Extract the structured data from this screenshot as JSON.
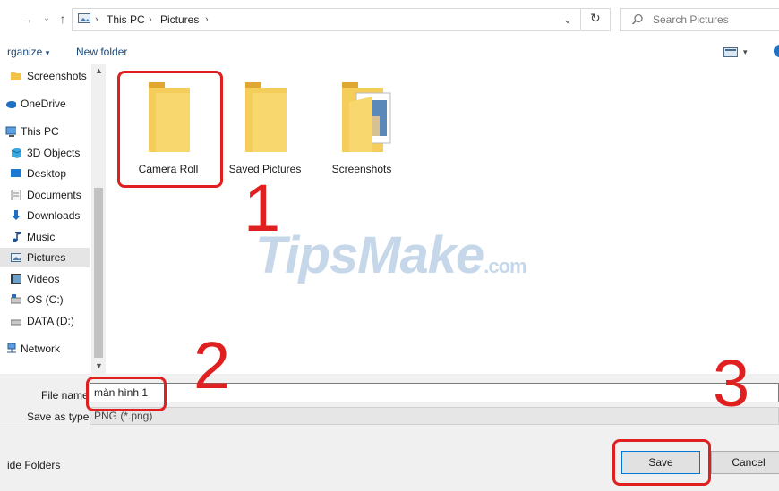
{
  "address_bar": {
    "breadcrumbs": [
      "This PC",
      "Pictures"
    ],
    "search_placeholder": "Search Pictures"
  },
  "command_bar": {
    "organize_label": "rganize",
    "new_folder_label": "New folder"
  },
  "nav_pane": {
    "items": [
      {
        "label": "Screenshots",
        "icon": "folder-icon",
        "selected": false
      },
      {
        "label": "OneDrive",
        "icon": "cloud-icon",
        "selected": false
      },
      {
        "label": "This PC",
        "icon": "computer-icon",
        "selected": false
      },
      {
        "label": "3D Objects",
        "icon": "cube-icon",
        "selected": false
      },
      {
        "label": "Desktop",
        "icon": "desktop-icon",
        "selected": false
      },
      {
        "label": "Documents",
        "icon": "document-icon",
        "selected": false
      },
      {
        "label": "Downloads",
        "icon": "download-icon",
        "selected": false
      },
      {
        "label": "Music",
        "icon": "music-icon",
        "selected": false
      },
      {
        "label": "Pictures",
        "icon": "pictures-icon",
        "selected": true
      },
      {
        "label": "Videos",
        "icon": "video-icon",
        "selected": false
      },
      {
        "label": "OS (C:)",
        "icon": "drive-icon",
        "selected": false
      },
      {
        "label": "DATA (D:)",
        "icon": "drive-icon",
        "selected": false
      },
      {
        "label": "Network",
        "icon": "network-icon",
        "selected": false
      }
    ]
  },
  "content": {
    "folders": [
      {
        "label": "Camera Roll",
        "icon": "folder-icon"
      },
      {
        "label": "Saved Pictures",
        "icon": "folder-icon"
      },
      {
        "label": "Screenshots",
        "icon": "folder-with-images-icon"
      }
    ]
  },
  "form": {
    "file_name_label": "File name",
    "file_name_value": "màn hình 1",
    "save_type_label": "Save as type:",
    "save_type_value": "PNG (*.png)"
  },
  "footer": {
    "hide_folders_label": "ide Folders",
    "save_label": "Save",
    "cancel_label": "Cancel"
  },
  "annotations": {
    "step1": "1",
    "step2": "2",
    "step3": "3",
    "color": "#e02020"
  },
  "watermark": {
    "main": "TipsMake",
    "suffix": ".com"
  }
}
